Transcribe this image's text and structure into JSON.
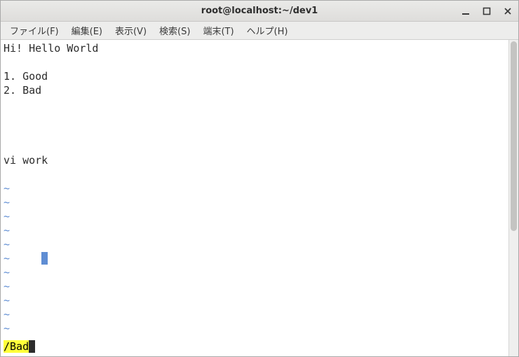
{
  "window": {
    "title": "root@localhost:~/dev1"
  },
  "menu": {
    "file": "ファイル(F)",
    "edit": "編集(E)",
    "view": "表示(V)",
    "search": "検索(S)",
    "terminal": "端末(T)",
    "help": "ヘルプ(H)"
  },
  "editor": {
    "lines": [
      "Hi! Hello World",
      "",
      "1. Good",
      "2. Bad",
      "",
      "",
      "",
      "",
      "vi work",
      ""
    ],
    "tilde": "~",
    "command": "/Bad"
  }
}
